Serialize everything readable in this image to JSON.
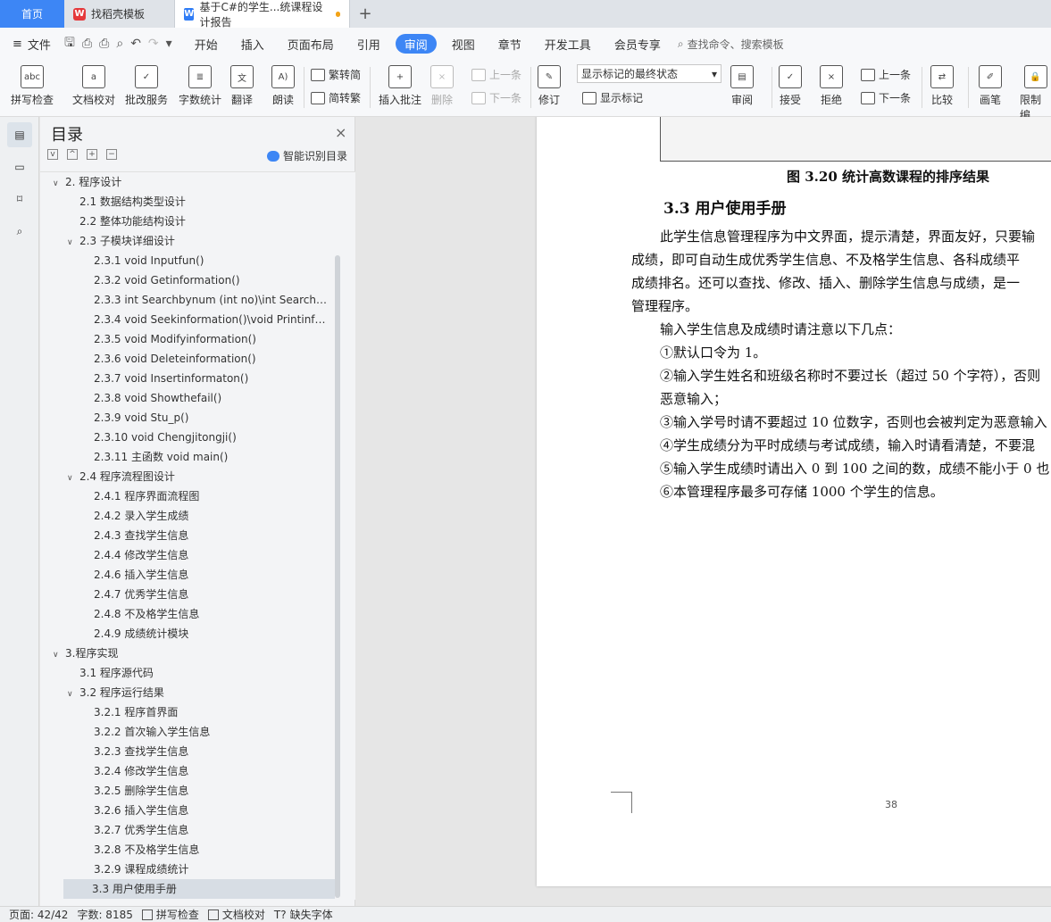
{
  "tabs": {
    "home": "首页",
    "template": "找稻壳模板",
    "document": "基于C#的学生...统课程设计报告"
  },
  "menubar": {
    "file": "文件",
    "items": [
      "开始",
      "插入",
      "页面布局",
      "引用",
      "审阅",
      "视图",
      "章节",
      "开发工具",
      "会员专享"
    ],
    "active": "审阅",
    "search_placeholder": "查找命令、搜索模板"
  },
  "ribbon": {
    "spell_check": "拼写检查",
    "doc_proof": "文档校对",
    "batch_service": "批改服务",
    "word_count": "字数统计",
    "translate": "翻译",
    "read_aloud": "朗读",
    "trad": "繁转简",
    "simp": "简转繁",
    "insert_comment": "插入批注",
    "delete": "删除",
    "prev": "上一条",
    "next": "下一条",
    "revise": "修订",
    "markup_state": "显示标记的最终状态",
    "show_markup": "显示标记",
    "review": "审阅",
    "accept": "接受",
    "reject": "拒绝",
    "prev2": "上一条",
    "next2": "下一条",
    "compare": "比较",
    "pen": "画笔",
    "restrict": "限制编"
  },
  "toc": {
    "title": "目录",
    "smart": "智能识别目录",
    "items": [
      {
        "text": "2. 程序设计",
        "level": 0,
        "caret": "v"
      },
      {
        "text": "2.1  数据结构类型设计",
        "level": 1,
        "caret": ""
      },
      {
        "text": "2.2  整体功能结构设计",
        "level": 1,
        "caret": ""
      },
      {
        "text": "2.3  子模块详细设计",
        "level": 1,
        "caret": "v"
      },
      {
        "text": "2.3.1 void Inputfun()",
        "level": 2,
        "caret": ""
      },
      {
        "text": "2.3.2 void Getinformation()",
        "level": 2,
        "caret": ""
      },
      {
        "text": "2.3.3 int Searchbynum (int no)\\int Searchby…",
        "level": 2,
        "caret": ""
      },
      {
        "text": "2.3.4 void Seekinformation()\\void Printinfor…",
        "level": 2,
        "caret": ""
      },
      {
        "text": "2.3.5 void Modifyinformation()",
        "level": 2,
        "caret": ""
      },
      {
        "text": "2.3.6 void Deleteinformation()",
        "level": 2,
        "caret": ""
      },
      {
        "text": "2.3.7 void Insertinformaton()",
        "level": 2,
        "caret": ""
      },
      {
        "text": "2.3.8 void Showthefail()",
        "level": 2,
        "caret": ""
      },
      {
        "text": "2.3.9 void Stu_p()",
        "level": 2,
        "caret": ""
      },
      {
        "text": "2.3.10 void Chengjitongji()",
        "level": 2,
        "caret": ""
      },
      {
        "text": "2.3.11  主函数 void main()",
        "level": 2,
        "caret": ""
      },
      {
        "text": "2.4  程序流程图设计",
        "level": 1,
        "caret": "v"
      },
      {
        "text": "2.4.1  程序界面流程图",
        "level": 2,
        "caret": ""
      },
      {
        "text": "2.4.2  录入学生成绩",
        "level": 2,
        "caret": ""
      },
      {
        "text": "2.4.3  查找学生信息",
        "level": 2,
        "caret": ""
      },
      {
        "text": "2.4.4  修改学生信息",
        "level": 2,
        "caret": ""
      },
      {
        "text": "2.4.6  插入学生信息",
        "level": 2,
        "caret": ""
      },
      {
        "text": "2.4.7  优秀学生信息",
        "level": 2,
        "caret": ""
      },
      {
        "text": "2.4.8  不及格学生信息",
        "level": 2,
        "caret": ""
      },
      {
        "text": "2.4.9  成绩统计模块",
        "level": 2,
        "caret": ""
      },
      {
        "text": "3.程序实现",
        "level": 0,
        "caret": "v"
      },
      {
        "text": "3.1  程序源代码",
        "level": 1,
        "caret": ""
      },
      {
        "text": "3.2  程序运行结果",
        "level": 1,
        "caret": "v"
      },
      {
        "text": "3.2.1  程序首界面",
        "level": 2,
        "caret": ""
      },
      {
        "text": "3.2.2  首次输入学生信息",
        "level": 2,
        "caret": ""
      },
      {
        "text": "3.2.3  查找学生信息",
        "level": 2,
        "caret": ""
      },
      {
        "text": "3.2.4  修改学生信息",
        "level": 2,
        "caret": ""
      },
      {
        "text": "3.2.5  删除学生信息",
        "level": 2,
        "caret": ""
      },
      {
        "text": "3.2.6  插入学生信息",
        "level": 2,
        "caret": ""
      },
      {
        "text": "3.2.7  优秀学生信息",
        "level": 2,
        "caret": ""
      },
      {
        "text": "3.2.8  不及格学生信息",
        "level": 2,
        "caret": ""
      },
      {
        "text": "3.2.9  课程成绩统计",
        "level": 2,
        "caret": ""
      },
      {
        "text": "3.3  用户使用手册",
        "level": 1,
        "caret": "",
        "selected": true
      }
    ]
  },
  "document": {
    "figure_caption": "图 3.20  统计高数课程的排序结果",
    "heading": "3.3  用户使用手册",
    "lines": [
      "此学生信息管理程序为中文界面，提示清楚，界面友好，只要输",
      "成绩，即可自动生成优秀学生信息、不及格学生信息、各科成绩平",
      "成绩排名。还可以查找、修改、插入、删除学生信息与成绩，是一",
      "管理程序。",
      "输入学生信息及成绩时请注意以下几点：",
      "①默认口令为 1。",
      "②输入学生姓名和班级名称时不要过长（超过 50 个字符），否则",
      "恶意输入；",
      "③输入学号时请不要超过 10 位数字，否则也会被判定为恶意输入",
      "④学生成绩分为平时成绩与考试成绩，输入时请看清楚，不要混",
      "⑤输入学生成绩时请出入 0 到 100 之间的数，成绩不能小于 0 也",
      "⑥本管理程序最多可存储 1000 个学生的信息。"
    ],
    "page_number": "38"
  },
  "status": {
    "page": "页面: 42/42",
    "words": "字数: 8185",
    "spell": "拼写检查",
    "proof": "文档校对",
    "missing_font": "缺失字体"
  }
}
